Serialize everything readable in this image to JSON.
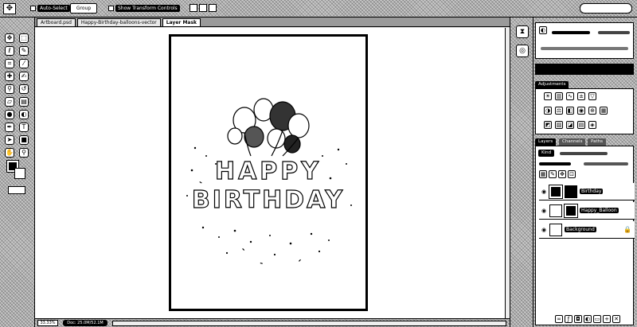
{
  "options_bar": {
    "move_tool_icon": "move-icon",
    "auto_select_label": "Auto-Select",
    "auto_select_target": "Group",
    "show_transform_label": "Show Transform Controls",
    "search_placeholder": ""
  },
  "toolbox": {
    "tools": [
      "move",
      "marquee",
      "lasso",
      "quick-select",
      "crop",
      "eyedropper",
      "spot-heal",
      "brush",
      "clone-stamp",
      "history-brush",
      "eraser",
      "gradient",
      "blur",
      "dodge",
      "pen",
      "type",
      "path-select",
      "shape",
      "hand",
      "zoom"
    ]
  },
  "tabs": [
    {
      "label": "Artboard.psd",
      "active": false
    },
    {
      "label": "Happy-Birthday-balloons-vector",
      "active": false
    },
    {
      "label": "Layer Mask",
      "active": true
    }
  ],
  "canvas": {
    "line1": "HAPPY",
    "line2": "BIRTHDAY"
  },
  "statusbar": {
    "zoom": "33.33%",
    "doc_info": "Doc: 25.0M/52.1M"
  },
  "panels": {
    "adjustments_title": "Adjustments",
    "layers_tabs": [
      "Layers",
      "Channels",
      "Paths"
    ],
    "kind_label": "Kind",
    "layers": [
      {
        "name": "Birthday",
        "thumb": "dark",
        "locked": false
      },
      {
        "name": "Happy_Balloon",
        "thumb": "white",
        "locked": false
      },
      {
        "name": "Background",
        "thumb": "white",
        "locked": true
      }
    ]
  },
  "colors": {
    "foreground": "#000000",
    "background": "#ffffff"
  }
}
